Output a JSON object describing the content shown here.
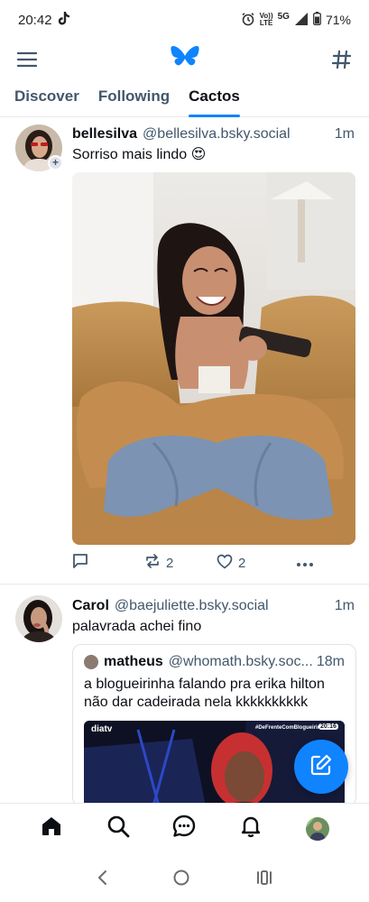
{
  "status_bar": {
    "time": "20:42",
    "network": "5G",
    "volte": "LTE",
    "battery": "71%"
  },
  "tabs": [
    {
      "label": "Discover"
    },
    {
      "label": "Following"
    },
    {
      "label": "Cactos"
    }
  ],
  "posts": [
    {
      "author": "bellesilva",
      "handle": "@bellesilva.bsky.social",
      "time": "1m",
      "text": "Sorriso mais lindo 😍",
      "reposts": "2",
      "likes": "2"
    },
    {
      "author": "Carol",
      "handle": "@baejuliette.bsky.social",
      "time": "1m",
      "text": "palavrada achei fino",
      "quote": {
        "author": "matheus",
        "handle": "@whomath.bsky.soc...",
        "time": "18m",
        "text": "a blogueirinha falando pra erika hilton não dar cadeirada nela kkkkkkkkkk",
        "video_logo": "diatv",
        "video_tag": "#DeFrenteComBlogueirinha",
        "video_time": "20:16"
      }
    }
  ],
  "icons": {
    "menu": "menu-icon",
    "logo": "butterfly-logo",
    "feeds": "hash-icon",
    "compose": "compose-icon"
  },
  "colors": {
    "accent": "#1083fe",
    "muted": "#42576c"
  }
}
